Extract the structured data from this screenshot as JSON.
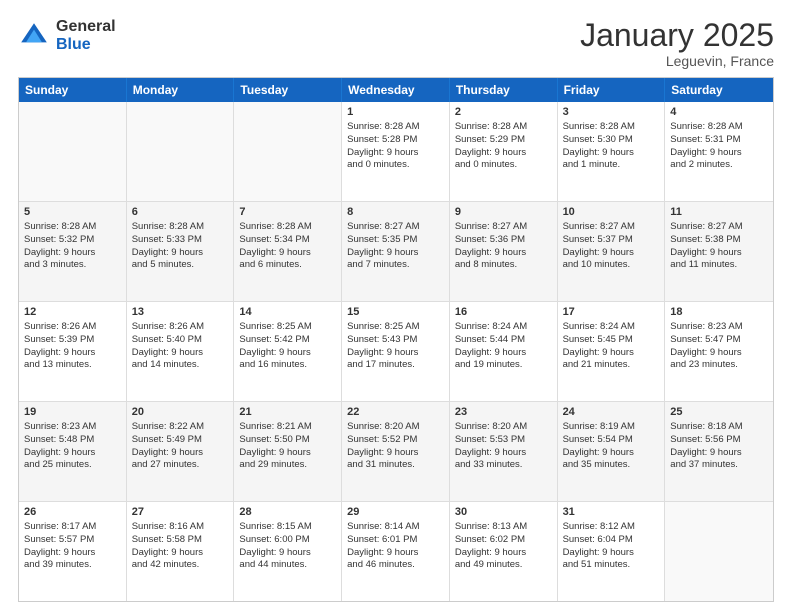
{
  "logo": {
    "general": "General",
    "blue": "Blue"
  },
  "title": "January 2025",
  "location": "Leguevin, France",
  "days": [
    "Sunday",
    "Monday",
    "Tuesday",
    "Wednesday",
    "Thursday",
    "Friday",
    "Saturday"
  ],
  "weeks": [
    [
      {
        "day": "",
        "lines": []
      },
      {
        "day": "",
        "lines": []
      },
      {
        "day": "",
        "lines": []
      },
      {
        "day": "1",
        "lines": [
          "Sunrise: 8:28 AM",
          "Sunset: 5:28 PM",
          "Daylight: 9 hours",
          "and 0 minutes."
        ]
      },
      {
        "day": "2",
        "lines": [
          "Sunrise: 8:28 AM",
          "Sunset: 5:29 PM",
          "Daylight: 9 hours",
          "and 0 minutes."
        ]
      },
      {
        "day": "3",
        "lines": [
          "Sunrise: 8:28 AM",
          "Sunset: 5:30 PM",
          "Daylight: 9 hours",
          "and 1 minute."
        ]
      },
      {
        "day": "4",
        "lines": [
          "Sunrise: 8:28 AM",
          "Sunset: 5:31 PM",
          "Daylight: 9 hours",
          "and 2 minutes."
        ]
      }
    ],
    [
      {
        "day": "5",
        "lines": [
          "Sunrise: 8:28 AM",
          "Sunset: 5:32 PM",
          "Daylight: 9 hours",
          "and 3 minutes."
        ]
      },
      {
        "day": "6",
        "lines": [
          "Sunrise: 8:28 AM",
          "Sunset: 5:33 PM",
          "Daylight: 9 hours",
          "and 5 minutes."
        ]
      },
      {
        "day": "7",
        "lines": [
          "Sunrise: 8:28 AM",
          "Sunset: 5:34 PM",
          "Daylight: 9 hours",
          "and 6 minutes."
        ]
      },
      {
        "day": "8",
        "lines": [
          "Sunrise: 8:27 AM",
          "Sunset: 5:35 PM",
          "Daylight: 9 hours",
          "and 7 minutes."
        ]
      },
      {
        "day": "9",
        "lines": [
          "Sunrise: 8:27 AM",
          "Sunset: 5:36 PM",
          "Daylight: 9 hours",
          "and 8 minutes."
        ]
      },
      {
        "day": "10",
        "lines": [
          "Sunrise: 8:27 AM",
          "Sunset: 5:37 PM",
          "Daylight: 9 hours",
          "and 10 minutes."
        ]
      },
      {
        "day": "11",
        "lines": [
          "Sunrise: 8:27 AM",
          "Sunset: 5:38 PM",
          "Daylight: 9 hours",
          "and 11 minutes."
        ]
      }
    ],
    [
      {
        "day": "12",
        "lines": [
          "Sunrise: 8:26 AM",
          "Sunset: 5:39 PM",
          "Daylight: 9 hours",
          "and 13 minutes."
        ]
      },
      {
        "day": "13",
        "lines": [
          "Sunrise: 8:26 AM",
          "Sunset: 5:40 PM",
          "Daylight: 9 hours",
          "and 14 minutes."
        ]
      },
      {
        "day": "14",
        "lines": [
          "Sunrise: 8:25 AM",
          "Sunset: 5:42 PM",
          "Daylight: 9 hours",
          "and 16 minutes."
        ]
      },
      {
        "day": "15",
        "lines": [
          "Sunrise: 8:25 AM",
          "Sunset: 5:43 PM",
          "Daylight: 9 hours",
          "and 17 minutes."
        ]
      },
      {
        "day": "16",
        "lines": [
          "Sunrise: 8:24 AM",
          "Sunset: 5:44 PM",
          "Daylight: 9 hours",
          "and 19 minutes."
        ]
      },
      {
        "day": "17",
        "lines": [
          "Sunrise: 8:24 AM",
          "Sunset: 5:45 PM",
          "Daylight: 9 hours",
          "and 21 minutes."
        ]
      },
      {
        "day": "18",
        "lines": [
          "Sunrise: 8:23 AM",
          "Sunset: 5:47 PM",
          "Daylight: 9 hours",
          "and 23 minutes."
        ]
      }
    ],
    [
      {
        "day": "19",
        "lines": [
          "Sunrise: 8:23 AM",
          "Sunset: 5:48 PM",
          "Daylight: 9 hours",
          "and 25 minutes."
        ]
      },
      {
        "day": "20",
        "lines": [
          "Sunrise: 8:22 AM",
          "Sunset: 5:49 PM",
          "Daylight: 9 hours",
          "and 27 minutes."
        ]
      },
      {
        "day": "21",
        "lines": [
          "Sunrise: 8:21 AM",
          "Sunset: 5:50 PM",
          "Daylight: 9 hours",
          "and 29 minutes."
        ]
      },
      {
        "day": "22",
        "lines": [
          "Sunrise: 8:20 AM",
          "Sunset: 5:52 PM",
          "Daylight: 9 hours",
          "and 31 minutes."
        ]
      },
      {
        "day": "23",
        "lines": [
          "Sunrise: 8:20 AM",
          "Sunset: 5:53 PM",
          "Daylight: 9 hours",
          "and 33 minutes."
        ]
      },
      {
        "day": "24",
        "lines": [
          "Sunrise: 8:19 AM",
          "Sunset: 5:54 PM",
          "Daylight: 9 hours",
          "and 35 minutes."
        ]
      },
      {
        "day": "25",
        "lines": [
          "Sunrise: 8:18 AM",
          "Sunset: 5:56 PM",
          "Daylight: 9 hours",
          "and 37 minutes."
        ]
      }
    ],
    [
      {
        "day": "26",
        "lines": [
          "Sunrise: 8:17 AM",
          "Sunset: 5:57 PM",
          "Daylight: 9 hours",
          "and 39 minutes."
        ]
      },
      {
        "day": "27",
        "lines": [
          "Sunrise: 8:16 AM",
          "Sunset: 5:58 PM",
          "Daylight: 9 hours",
          "and 42 minutes."
        ]
      },
      {
        "day": "28",
        "lines": [
          "Sunrise: 8:15 AM",
          "Sunset: 6:00 PM",
          "Daylight: 9 hours",
          "and 44 minutes."
        ]
      },
      {
        "day": "29",
        "lines": [
          "Sunrise: 8:14 AM",
          "Sunset: 6:01 PM",
          "Daylight: 9 hours",
          "and 46 minutes."
        ]
      },
      {
        "day": "30",
        "lines": [
          "Sunrise: 8:13 AM",
          "Sunset: 6:02 PM",
          "Daylight: 9 hours",
          "and 49 minutes."
        ]
      },
      {
        "day": "31",
        "lines": [
          "Sunrise: 8:12 AM",
          "Sunset: 6:04 PM",
          "Daylight: 9 hours",
          "and 51 minutes."
        ]
      },
      {
        "day": "",
        "lines": []
      }
    ]
  ]
}
